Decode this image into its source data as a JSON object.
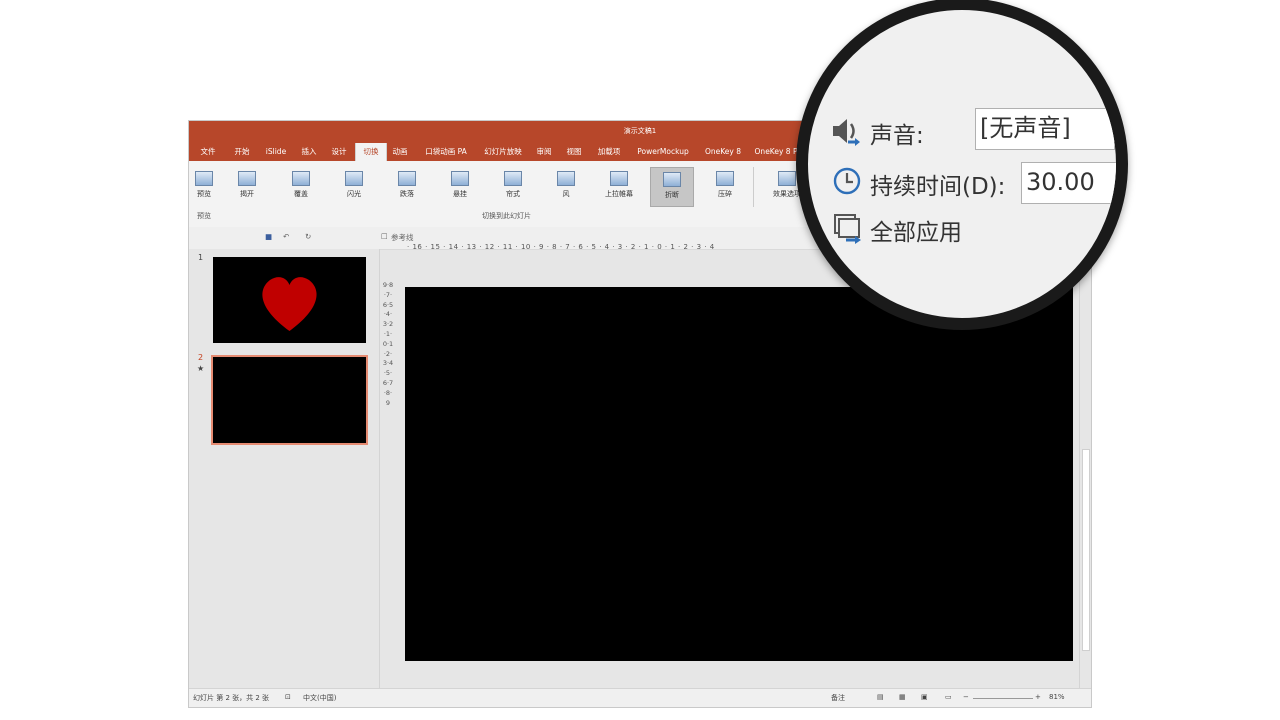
{
  "window": {
    "title": "演示文稿1"
  },
  "tabs": [
    "文件",
    "开始",
    "iSlide",
    "插入",
    "设计",
    "切换",
    "动画",
    "口袋动画 PA",
    "幻灯片放映",
    "审阅",
    "视图",
    "加载项",
    "PowerMockup",
    "OneKey 8",
    "OneKey 8 P"
  ],
  "active_tab": "切换",
  "ribbon": {
    "preview_label": "预览",
    "preview_group": "预览",
    "transitions": [
      "揭开",
      "覆盖",
      "闪光",
      "跌落",
      "悬挂",
      "帘式",
      "风",
      "上拉帷幕",
      "折断",
      "压碎"
    ],
    "selected_transition": "折断",
    "effect_options": "效果选项",
    "transition_group": "切换到此幻灯片"
  },
  "qat": {
    "ref_line_label": "参考线"
  },
  "ruler": {
    "horizontal": "· 16 · 15 · 14 · 13 · 12 · 11 · 10 · 9 · 8 · 7 · 6 · 5 · 4 · 3 · 2 · 1 · 0 · 1 · 2 · 3 · 4",
    "vertical": "9·8·7·6·5·4·3·2·1·0·1·2·3·4·5·6·7·8·9"
  },
  "slides": [
    {
      "number": "1",
      "marker": ""
    },
    {
      "number": "2",
      "marker": "★"
    }
  ],
  "statusbar": {
    "slide_info": "幻灯片 第 2 张，共 2 张",
    "language": "中文(中国)",
    "notes": "备注",
    "zoom": "81%"
  },
  "magnifier": {
    "sound_label": "声音:",
    "sound_value": "[无声音]",
    "duration_label": "持续时间(D):",
    "duration_value": "30.00",
    "apply_all_label": "全部应用"
  },
  "colors": {
    "accent": "#b7472a",
    "heart": "#c00000"
  }
}
